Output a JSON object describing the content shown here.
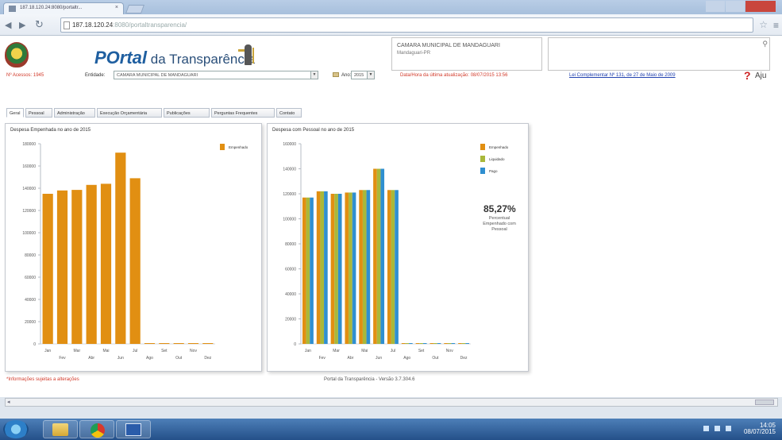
{
  "browser": {
    "tab_title": "187.18.120.24:8080/portaltr...",
    "tab_close": "×",
    "url_host": "187.18.120.24",
    "url_path": ":8080/portaltransparencia/"
  },
  "site": {
    "logo_p": "POrtal",
    "logo_da": " da Transparência",
    "org_name": "CAMARA MUNICIPAL DE MANDAGUARI",
    "org_city": "Mandaguari-PR"
  },
  "filters": {
    "access": "Nº Acessos: 1945",
    "entity_label": "Entidade:",
    "entity_value": "CAMARA MUNICIPAL DE MANDAGUARI",
    "year_label": "Ano:",
    "year_value": "2015",
    "update": "Data/Hora da última atualização: 08/07/2015 13:56",
    "law": "Lei Complementar Nº 131, de 27 de Maio de 2009",
    "help": "Aju"
  },
  "tabs": [
    {
      "label": "Geral"
    },
    {
      "label": "Pessoal"
    },
    {
      "label": "Administração"
    },
    {
      "label": "Execução Orçamentária"
    },
    {
      "label": "Publicações"
    },
    {
      "label": "Perguntas Frequentes"
    },
    {
      "label": "Contato"
    }
  ],
  "footer": {
    "left": "*Informações sujeitas a alterações",
    "mid": "Portal da Transparência - Versão 3.7.304.6"
  },
  "colors": {
    "empenhado": "#e18f12",
    "liquidado": "#a9b83a",
    "pago": "#2f8fd0"
  },
  "chart_data": [
    {
      "type": "bar",
      "title": "Despesa Empenhada no ano de 2015",
      "categories": [
        "Jan",
        "Fev",
        "Mar",
        "Abr",
        "Mai",
        "Jun",
        "Jul",
        "Ago",
        "Set",
        "Out",
        "Nov",
        "Dez"
      ],
      "tick_labels_top": [
        "Jan",
        "",
        "Mar",
        "",
        "Mai",
        "",
        "Jul",
        "",
        "Set",
        "",
        "Nov",
        ""
      ],
      "tick_labels_bottom": [
        "",
        "Fev",
        "",
        "Abr",
        "",
        "Jun",
        "",
        "Ago",
        "",
        "Out",
        "",
        "Dez"
      ],
      "series": [
        {
          "name": "Empenhado",
          "values": [
            135000,
            138000,
            138500,
            143000,
            144000,
            172000,
            149000,
            0,
            0,
            0,
            0,
            0
          ]
        }
      ],
      "ylim": [
        0,
        180000
      ],
      "yticks": [
        "0",
        "20000",
        "40000",
        "60000",
        "80000",
        "100000",
        "120000",
        "140000",
        "160000",
        "180000"
      ],
      "legend": "top-right"
    },
    {
      "type": "bar",
      "title": "Despesa com Pessoal no ano de 2015",
      "categories": [
        "Jan",
        "Fev",
        "Mar",
        "Abr",
        "Mai",
        "Jun",
        "Jul",
        "Ago",
        "Set",
        "Out",
        "Nov",
        "Dez"
      ],
      "tick_labels_top": [
        "Jan",
        "",
        "Mar",
        "",
        "Mai",
        "",
        "Jul",
        "",
        "Set",
        "",
        "Nov",
        ""
      ],
      "tick_labels_bottom": [
        "",
        "Fev",
        "",
        "Abr",
        "",
        "Jun",
        "",
        "Ago",
        "",
        "Out",
        "",
        "Dez"
      ],
      "series": [
        {
          "name": "Empenhado",
          "values": [
            117000,
            122000,
            120000,
            121000,
            123000,
            140000,
            123000,
            0,
            0,
            0,
            0,
            0
          ]
        },
        {
          "name": "Liquidado",
          "values": [
            117000,
            122000,
            120000,
            121000,
            123000,
            140000,
            123000,
            0,
            0,
            0,
            0,
            0
          ]
        },
        {
          "name": "Pago",
          "values": [
            117000,
            122000,
            120000,
            121000,
            123000,
            140000,
            123000,
            0,
            0,
            0,
            0,
            0
          ]
        }
      ],
      "ylim": [
        0,
        160000
      ],
      "yticks": [
        "0",
        "20000",
        "40000",
        "60000",
        "80000",
        "100000",
        "120000",
        "140000",
        "160000"
      ],
      "legend": "top-right",
      "percent": "85,27%",
      "percent_label": "Percentual Empenhado com Pessoal"
    }
  ],
  "taskbar": {
    "time": "14:05",
    "date": "08/07/2015"
  }
}
